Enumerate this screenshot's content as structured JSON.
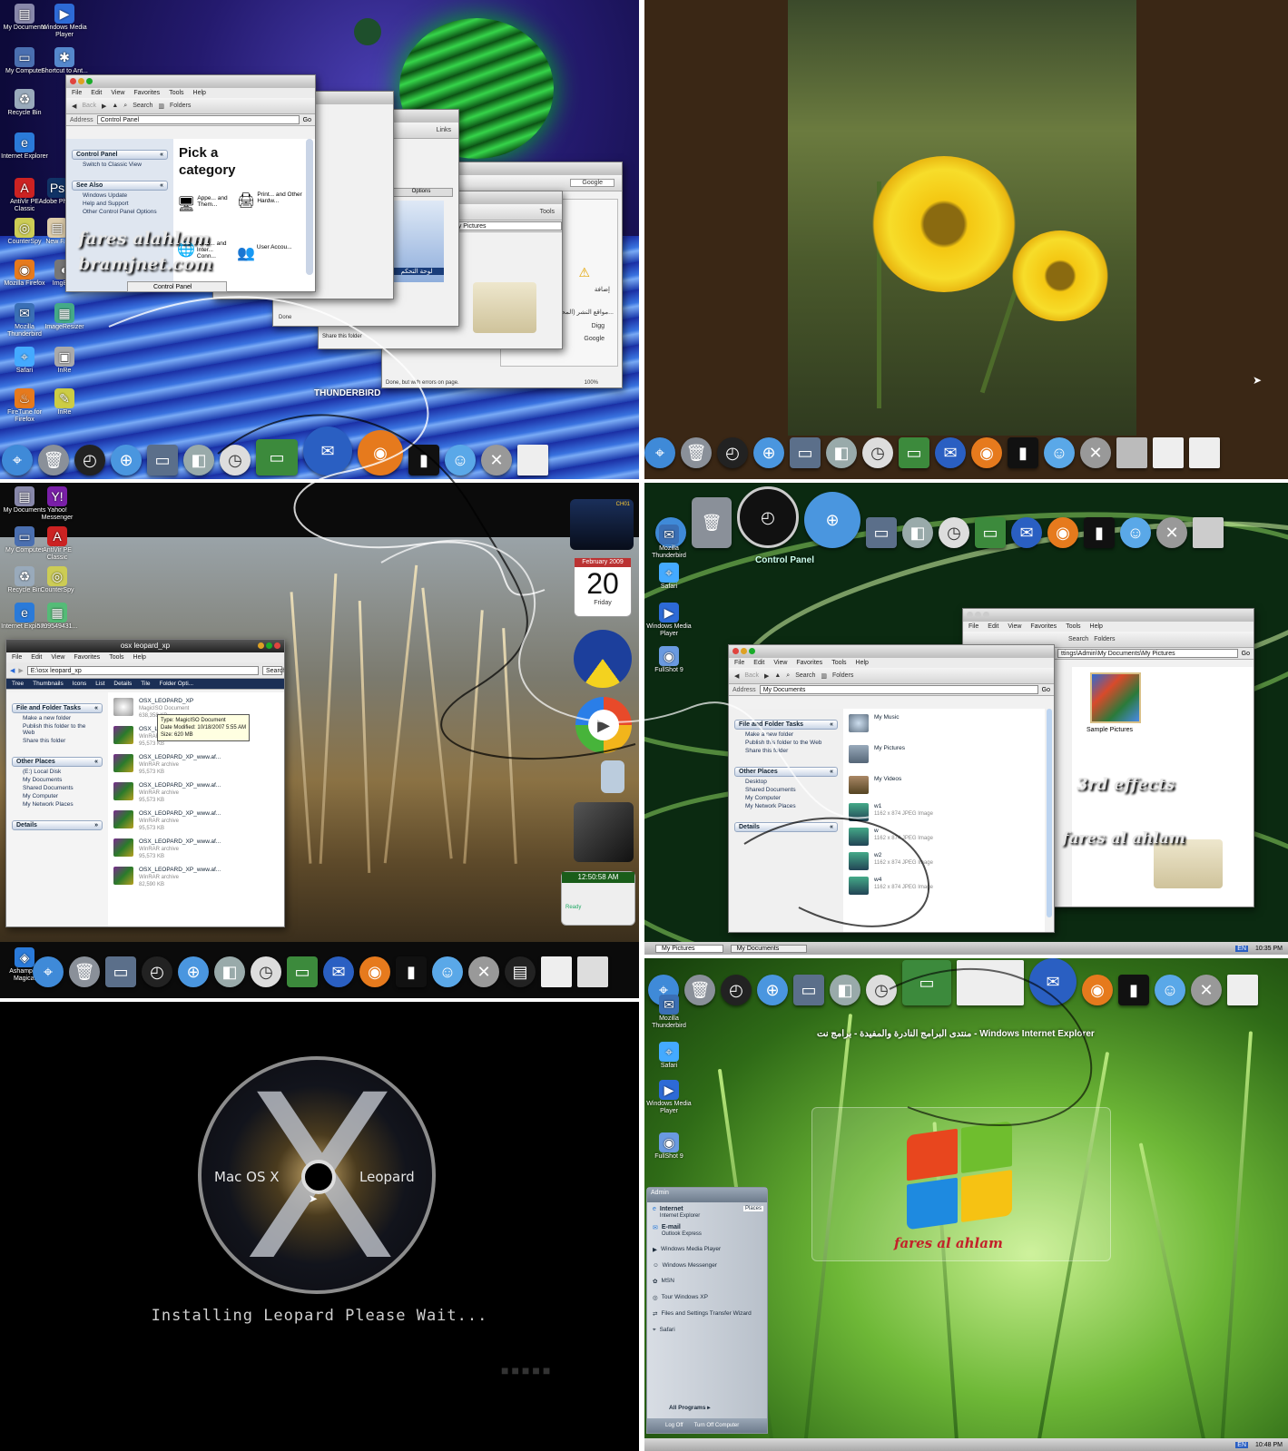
{
  "panel1": {
    "desktop_icons": [
      "My Documents",
      "Windows Media Player",
      "My Computer",
      "Shortcut to Ant...",
      "Recycle Bin",
      "Internet Explorer",
      "AntiVir PE Classic",
      "Adobe Pho...",
      "CounterSpy",
      "New F...",
      "Mozilla Firefox",
      "ImgBurn",
      "Mozilla Thunderbird",
      "ImageResizer",
      "Safari",
      "InRe",
      "FireTune for Firefox",
      "InRe"
    ],
    "control_panel": {
      "menu": [
        "File",
        "Edit",
        "View",
        "Favorites",
        "Tools",
        "Help"
      ],
      "toolbar": [
        "Back",
        "Search",
        "Folders"
      ],
      "address_label": "Address",
      "address_value": "Control Panel",
      "go": "Go",
      "side_header": "Control Panel",
      "switch_view": "Switch to Classic View",
      "see_also": "See Also",
      "see_also_items": [
        "Windows Update",
        "Help and Support",
        "Other Control Panel Options"
      ],
      "heading_line1": "Pick a",
      "heading_line2": "category",
      "categories": [
        "Appe... and Them...",
        "Print... and Other Hardw...",
        "Netw... and Inter... Conn...",
        "User Accou..."
      ],
      "status": "Control Panel"
    },
    "back_windows": {
      "google_placeholder": "Google",
      "links": "Links",
      "options": "Options",
      "arabic_panel": "لوحة التحكم",
      "my_pictures": "My Pictures",
      "tools": "Tools",
      "arabic_add": "إضافة",
      "arabic_sites": "مواقع النشر (المحم...",
      "digg": "Digg",
      "google": "Google",
      "share": "Share this folder",
      "publish": "Publish this folder",
      "status_done": "Done, but with errors on page.",
      "zoom": "100%",
      "done": "Done"
    },
    "watermark1": "fares alahlam",
    "watermark2": "bramjnet.com",
    "dock_label": "THUNDERBIRD"
  },
  "panel3": {
    "desktop_icons": [
      "My Documents",
      "Yahoo! Messenger",
      "My Computer",
      "AntiVir PE Classic",
      "Recycle Bin",
      "CounterSpy",
      "Internet Explorer",
      "5709549431..."
    ],
    "window": {
      "title": "osx leopard_xp",
      "menu": [
        "File",
        "Edit",
        "View",
        "Favorites",
        "Tools",
        "Help"
      ],
      "address": "E:\\osx leopard_xp",
      "search": "Search",
      "toolbar": [
        "Tree",
        "Thumbnails",
        "Icons",
        "List",
        "Details",
        "Tile",
        "Folder Opti..."
      ],
      "tasks_header": "File and Folder Tasks",
      "tasks": [
        "Make a new folder",
        "Publish this folder to the Web",
        "Share this folder"
      ],
      "places_header": "Other Places",
      "places": [
        "(E:) Local Disk",
        "My Documents",
        "Shared Documents",
        "My Computer",
        "My Network Places"
      ],
      "details_header": "Details",
      "files": [
        {
          "name": "OSX_LEOPARD_XP",
          "type": "MagicISO Document",
          "size": "638,358 KB"
        },
        {
          "name": "OSX_LE...",
          "type": "WinRAR archive",
          "size": "95,573 KB"
        },
        {
          "name": "OSX_LEOPARD_XP_www.af...",
          "type": "WinRAR archive",
          "size": "95,573 KB"
        },
        {
          "name": "OSX_LEOPARD_XP_www.af...",
          "type": "WinRAR archive",
          "size": "95,573 KB"
        },
        {
          "name": "OSX_LEOPARD_XP_www.af...",
          "type": "WinRAR archive",
          "size": "95,573 KB"
        },
        {
          "name": "OSX_LEOPARD_XP_www.af...",
          "type": "WinRAR archive",
          "size": "95,573 KB"
        },
        {
          "name": "OSX_LEOPARD_XP_www.af...",
          "type": "WinRAR archive",
          "size": "82,590 KB"
        }
      ],
      "tooltip": [
        "Type: MagicISO Document",
        "Date Modified: 10/18/2007 5:55 AM",
        "Size: 620 MB"
      ]
    },
    "calendar": {
      "month": "February 2009",
      "day": "20",
      "weekday": "Friday"
    },
    "clock": "12:50:58 AM",
    "cpu": "CH01",
    "ready": "Ready",
    "bottom_left": "Ashampoo Magical"
  },
  "panel4": {
    "side_icons": [
      "Mozilla Thunderbird",
      "Safari",
      "Windows Media Player",
      "FullShot 9"
    ],
    "control_label": "Control Panel",
    "front_window": {
      "menu": [
        "File",
        "Edit",
        "View",
        "Favorites",
        "Tools",
        "Help"
      ],
      "toolbar": [
        "Back",
        "Search",
        "Folders"
      ],
      "address_label": "Address",
      "address_value": "My Documents",
      "go": "Go",
      "tasks_header": "File and Folder Tasks",
      "tasks": [
        "Make a new folder",
        "Publish this folder to the Web",
        "Share this folder"
      ],
      "places_header": "Other Places",
      "places": [
        "Desktop",
        "Shared Documents",
        "My Computer",
        "My Network Places"
      ],
      "details_header": "Details",
      "items": [
        {
          "name": "My Music",
          "sub": ""
        },
        {
          "name": "My Pictures",
          "sub": ""
        },
        {
          "name": "My Videos",
          "sub": ""
        },
        {
          "name": "w1",
          "sub": "1162 x 874 JPEG Image"
        },
        {
          "name": "w",
          "sub": "1162 x 874 JPEG Image"
        },
        {
          "name": "w2",
          "sub": "1162 x 874 JPEG Image"
        },
        {
          "name": "w4",
          "sub": "1162 x 874 JPEG Image"
        }
      ]
    },
    "back_window": {
      "menu": [
        "File",
        "Edit",
        "View",
        "Favorites",
        "Tools",
        "Help"
      ],
      "search": "Search",
      "folders": "Folders",
      "address_value": "ttings\\Admin\\My Documents\\My Pictures",
      "go": "Go",
      "folder_name": "Sample Pictures"
    },
    "watermark1": "3rd effects",
    "watermark2": "fares al ahlam",
    "taskbar": [
      "My Pictures",
      "My Documents"
    ],
    "lang": "EN",
    "time": "10:35 PM"
  },
  "panel5": {
    "disc_left": "Mac OS X",
    "disc_right": "Leopard",
    "install_text": "Installing Leopard Please Wait..."
  },
  "panel6": {
    "side_icons": [
      "Mozilla Thunderbird",
      "Safari",
      "Windows Media Player",
      "FullShot 9"
    ],
    "ie_title": "منتدى البرامج النادرة والمفيدة - برامج نت - Windows Internet Explorer",
    "watermark": "fares al ahlam",
    "start_menu": {
      "user": "Admin",
      "places": "Places",
      "pinned": [
        {
          "title": "Internet",
          "sub": "Internet Explorer"
        },
        {
          "title": "E-mail",
          "sub": "Outlook Express"
        }
      ],
      "programs": [
        "Windows Media Player",
        "Windows Messenger",
        "MSN",
        "Tour Windows XP",
        "Files and Settings Transfer Wizard",
        "Safari"
      ],
      "all_programs": "All Programs",
      "log_off": "Log Off",
      "turn_off": "Turn Off Computer"
    },
    "lang": "EN",
    "time": "10:48 PM"
  }
}
